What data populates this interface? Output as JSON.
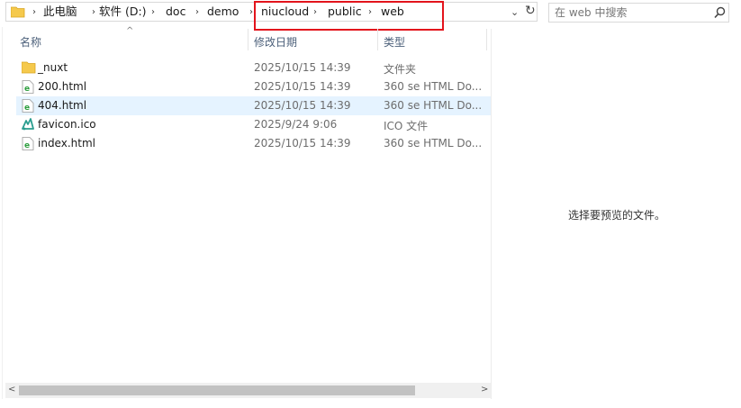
{
  "address_bar": {
    "crumbs": [
      "此电脑",
      "软件 (D:)",
      "doc",
      "demo",
      "niucloud",
      "public",
      "web"
    ]
  },
  "search": {
    "placeholder": "在 web 中搜索"
  },
  "columns": {
    "name": "名称",
    "date": "修改日期",
    "type": "类型"
  },
  "files": [
    {
      "name": "_nuxt",
      "date": "2025/10/15 14:39",
      "type": "文件夹",
      "icon": "folder-icon"
    },
    {
      "name": "200.html",
      "date": "2025/10/15 14:39",
      "type": "360 se HTML Do...",
      "icon": "html-file-icon"
    },
    {
      "name": "404.html",
      "date": "2025/10/15 14:39",
      "type": "360 se HTML Do...",
      "icon": "html-file-icon"
    },
    {
      "name": "favicon.ico",
      "date": "2025/9/24 9:06",
      "type": "ICO 文件",
      "icon": "ico-file-icon"
    },
    {
      "name": "index.html",
      "date": "2025/10/15 14:39",
      "type": "360 se HTML Do...",
      "icon": "html-file-icon"
    }
  ],
  "preview": {
    "message": "选择要预览的文件。"
  },
  "colors": {
    "selection": "#e5f3ff",
    "highlight_box": "#e3141c",
    "folder": "#f5c94c",
    "html_icon": "#2e9e3e"
  }
}
